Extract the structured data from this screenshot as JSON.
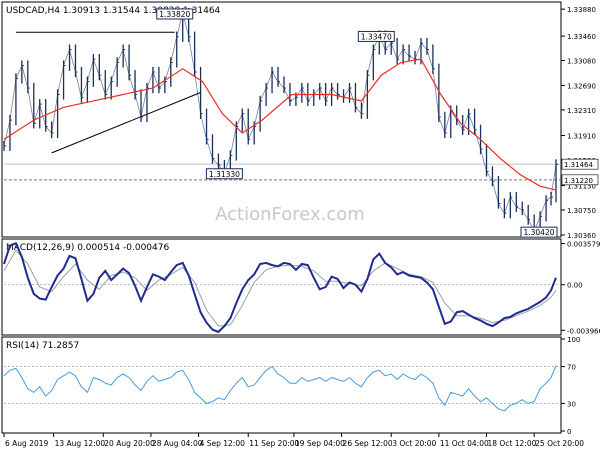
{
  "colors": {
    "background": "#ffffff",
    "frame": "#000000",
    "price_bars": "#1a2e5a",
    "moving_average": "#e8302a",
    "macd_line": "#1f2c8f",
    "macd_signal": "#9aa0a6",
    "rsi_line": "#4a9bd8",
    "level_line": "#7a7a7a",
    "label_border": "#1a2e5a",
    "watermark": "#c8c8c8"
  },
  "watermark": "ActionForex.com",
  "chart_data": [
    {
      "type": "line",
      "panel": "price",
      "title": "USDCAD,H4  1.30913 1.31544 1.30828 1.31464",
      "ylim": [
        1.3036,
        1.3396
      ],
      "y_ticks": [
        1.3388,
        1.3346,
        1.3308,
        1.3269,
        1.3231,
        1.3191,
        1.3153,
        1.3113,
        1.3075,
        1.3036
      ],
      "y_tick_labels": [
        "1.33880",
        "1.33460",
        "1.33080",
        "1.32690",
        "1.32310",
        "1.31910",
        "1.31530",
        "1.31130",
        "1.30750",
        "1.30360"
      ],
      "current_price_label": "1.31464",
      "current_price": 1.31464,
      "level_label": "1.31220",
      "level_price": 1.3122,
      "series": [
        {
          "name": "",
          "kind": "price",
          "x": [
            0,
            6,
            12,
            18,
            24,
            30,
            36,
            42,
            48,
            54,
            60,
            66,
            72,
            78,
            84,
            90,
            96,
            102,
            108,
            114,
            120,
            126,
            132,
            138,
            144,
            150,
            156,
            162,
            168,
            174,
            180,
            186,
            192,
            198,
            204,
            210,
            216,
            222,
            228,
            234,
            240,
            246,
            252,
            258,
            264,
            270,
            276,
            282,
            288,
            294,
            300,
            306,
            312,
            318,
            324,
            330,
            336,
            342,
            348,
            354,
            360,
            366,
            372,
            378,
            384,
            390,
            396,
            402,
            408,
            414,
            420,
            426,
            432,
            438,
            444,
            450,
            456,
            462,
            468,
            474,
            480,
            486,
            492,
            498,
            504,
            510,
            516,
            522,
            528,
            534,
            540,
            546,
            551,
            556
          ],
          "values": [
            1.3175,
            1.3215,
            1.328,
            1.33,
            1.3265,
            1.321,
            1.324,
            1.3205,
            1.3195,
            1.3255,
            1.33,
            1.3325,
            1.329,
            1.325,
            1.3275,
            1.331,
            1.3285,
            1.3255,
            1.3275,
            1.3305,
            1.3325,
            1.3285,
            1.3255,
            1.322,
            1.3265,
            1.329,
            1.3265,
            1.3275,
            1.3305,
            1.3345,
            1.3382,
            1.3345,
            1.329,
            1.3225,
            1.3185,
            1.3155,
            1.3145,
            1.3133,
            1.316,
            1.3205,
            1.3225,
            1.3185,
            1.3205,
            1.3245,
            1.3265,
            1.329,
            1.3275,
            1.3265,
            1.3245,
            1.325,
            1.3265,
            1.3245,
            1.3255,
            1.3265,
            1.3245,
            1.3265,
            1.3255,
            1.325,
            1.3265,
            1.3235,
            1.3225,
            1.3285,
            1.3325,
            1.3347,
            1.3325,
            1.3335,
            1.331,
            1.3325,
            1.3315,
            1.331,
            1.3335,
            1.3325,
            1.3295,
            1.322,
            1.3195,
            1.323,
            1.3215,
            1.32,
            1.3225,
            1.32,
            1.317,
            1.3135,
            1.312,
            1.3085,
            1.307,
            1.3095,
            1.308,
            1.3075,
            1.306,
            1.3042,
            1.3065,
            1.309,
            1.3095,
            1.3146
          ]
        },
        {
          "name": "",
          "kind": "moving-average",
          "x": [
            0,
            30,
            60,
            90,
            120,
            150,
            180,
            200,
            220,
            240,
            260,
            290,
            330,
            360,
            380,
            400,
            420,
            440,
            460,
            480,
            500,
            520,
            540,
            556
          ],
          "values": [
            1.3185,
            1.3215,
            1.3235,
            1.3245,
            1.3255,
            1.3265,
            1.3295,
            1.3275,
            1.3225,
            1.3195,
            1.3215,
            1.3255,
            1.3255,
            1.3245,
            1.3285,
            1.3305,
            1.331,
            1.3255,
            1.321,
            1.3185,
            1.3155,
            1.313,
            1.3112,
            1.3106
          ]
        }
      ],
      "annotations": [
        {
          "label": "1.33820",
          "x": 172,
          "value": 1.3382
        },
        {
          "label": "1.33470",
          "x": 375,
          "value": 1.3347
        },
        {
          "label": "1.31330",
          "x": 222,
          "value": 1.3133
        },
        {
          "label": "1.30420",
          "x": 540,
          "value": 1.3042
        }
      ],
      "channel": {
        "upper": {
          "x": [
            12,
            172
          ],
          "values": [
            1.3352,
            1.3352
          ]
        },
        "lower": {
          "x": [
            48,
            198
          ],
          "values": [
            1.3164,
            1.3258
          ]
        }
      }
    },
    {
      "type": "line",
      "panel": "macd",
      "title": "MACD(12,26,9) 0.000514 -0.000476",
      "ylim": [
        -0.0042,
        0.0038
      ],
      "y_ticks": [
        0.003579,
        0.0,
        -0.003966
      ],
      "y_tick_labels": [
        "0.003579",
        "0.00",
        "-0.003966"
      ],
      "series": [
        {
          "name": "",
          "kind": "macd",
          "x": [
            0,
            6,
            12,
            18,
            24,
            30,
            36,
            42,
            48,
            54,
            60,
            66,
            72,
            78,
            84,
            90,
            96,
            102,
            108,
            114,
            120,
            126,
            132,
            138,
            144,
            150,
            156,
            162,
            168,
            174,
            180,
            186,
            192,
            198,
            204,
            210,
            216,
            222,
            228,
            234,
            240,
            246,
            252,
            258,
            264,
            270,
            276,
            282,
            288,
            294,
            300,
            306,
            312,
            318,
            324,
            330,
            336,
            342,
            348,
            354,
            360,
            366,
            372,
            378,
            384,
            390,
            396,
            402,
            408,
            414,
            420,
            426,
            432,
            438,
            444,
            450,
            456,
            462,
            468,
            474,
            480,
            486,
            492,
            498,
            504,
            510,
            516,
            522,
            528,
            534,
            540,
            546,
            551,
            556
          ],
          "values": [
            0.0018,
            0.0034,
            0.0036,
            0.0024,
            0.0006,
            -0.0008,
            -0.0012,
            -0.0013,
            -0.0002,
            0.0008,
            0.0014,
            0.0025,
            0.0023,
            0.0005,
            -0.0014,
            -0.0008,
            0.0006,
            0.0012,
            0.0004,
            0.0009,
            0.0014,
            0.001,
            -0.0001,
            -0.0014,
            -0.0002,
            0.0009,
            0.0007,
            0.0004,
            0.0011,
            0.0017,
            0.0019,
            0.0008,
            -0.0008,
            -0.0024,
            -0.0033,
            -0.0039,
            -0.0041,
            -0.0036,
            -0.0029,
            -0.0016,
            -0.0004,
            0.0004,
            0.0009,
            0.0018,
            0.0019,
            0.0017,
            0.0016,
            0.0019,
            0.0018,
            0.0013,
            0.0018,
            0.0017,
            0.0006,
            -0.0004,
            -0.0002,
            0.0007,
            0.0005,
            -0.0003,
            0.0002,
            0.0,
            -0.0006,
            0.0005,
            0.0022,
            0.0027,
            0.0019,
            0.0015,
            0.0009,
            0.0011,
            0.0008,
            0.0007,
            0.0006,
            0.0002,
            -0.0004,
            -0.0019,
            -0.0034,
            -0.0032,
            -0.0024,
            -0.0023,
            -0.0026,
            -0.0029,
            -0.0031,
            -0.0034,
            -0.0036,
            -0.0033,
            -0.0029,
            -0.0028,
            -0.0025,
            -0.0023,
            -0.0021,
            -0.0018,
            -0.0015,
            -0.0011,
            -0.0005,
            0.0006
          ]
        },
        {
          "name": "",
          "kind": "signal",
          "x": [
            0,
            12,
            24,
            36,
            48,
            60,
            72,
            84,
            96,
            108,
            120,
            132,
            144,
            156,
            168,
            180,
            192,
            204,
            216,
            228,
            240,
            252,
            264,
            276,
            288,
            300,
            312,
            324,
            336,
            348,
            360,
            372,
            384,
            396,
            408,
            420,
            432,
            444,
            456,
            468,
            480,
            492,
            504,
            516,
            528,
            540,
            551,
            556
          ],
          "values": [
            0.0012,
            0.003,
            0.0018,
            -0.0002,
            -0.0006,
            0.0007,
            0.0018,
            0.0004,
            -0.0004,
            0.0008,
            0.0011,
            0.0006,
            -0.0005,
            0.0004,
            0.0009,
            0.0015,
            0.0002,
            -0.0022,
            -0.0036,
            -0.0035,
            -0.0018,
            0.0002,
            0.0013,
            0.0016,
            0.0017,
            0.0016,
            0.0012,
            0.0003,
            0.0003,
            0.0001,
            -0.0001,
            0.0012,
            0.0019,
            0.0014,
            0.0009,
            0.0007,
            0.0002,
            -0.0016,
            -0.0027,
            -0.0027,
            -0.0029,
            -0.0033,
            -0.0031,
            -0.0027,
            -0.0023,
            -0.0018,
            -0.0011,
            -0.0005
          ]
        }
      ]
    },
    {
      "type": "line",
      "panel": "rsi",
      "title": "RSI(14) 71.2857",
      "ylim": [
        0,
        100
      ],
      "y_ticks": [
        100,
        70,
        30,
        0
      ],
      "y_tick_labels": [
        "100",
        "70",
        "30",
        "0"
      ],
      "series": [
        {
          "name": "",
          "kind": "rsi",
          "x": [
            0,
            6,
            12,
            18,
            24,
            30,
            36,
            42,
            48,
            54,
            60,
            66,
            72,
            78,
            84,
            90,
            96,
            102,
            108,
            114,
            120,
            126,
            132,
            138,
            144,
            150,
            156,
            162,
            168,
            174,
            180,
            186,
            192,
            198,
            204,
            210,
            216,
            222,
            228,
            234,
            240,
            246,
            252,
            258,
            264,
            270,
            276,
            282,
            288,
            294,
            300,
            306,
            312,
            318,
            324,
            330,
            336,
            342,
            348,
            354,
            360,
            366,
            372,
            378,
            384,
            390,
            396,
            402,
            408,
            414,
            420,
            426,
            432,
            438,
            444,
            450,
            456,
            462,
            468,
            474,
            480,
            486,
            492,
            498,
            504,
            510,
            516,
            522,
            528,
            534,
            540,
            546,
            551,
            556
          ],
          "values": [
            60,
            66,
            68,
            58,
            46,
            42,
            48,
            38,
            44,
            56,
            60,
            64,
            60,
            48,
            42,
            58,
            56,
            52,
            50,
            58,
            62,
            58,
            50,
            44,
            54,
            60,
            54,
            56,
            58,
            64,
            66,
            56,
            42,
            36,
            30,
            32,
            36,
            34,
            44,
            52,
            58,
            48,
            50,
            58,
            66,
            70,
            62,
            58,
            52,
            52,
            58,
            54,
            56,
            58,
            54,
            58,
            56,
            54,
            58,
            52,
            48,
            58,
            64,
            66,
            60,
            62,
            56,
            62,
            58,
            56,
            62,
            58,
            52,
            36,
            28,
            42,
            40,
            38,
            46,
            38,
            32,
            36,
            30,
            24,
            22,
            28,
            30,
            34,
            30,
            32,
            46,
            52,
            58,
            71
          ]
        }
      ]
    }
  ],
  "x_axis": {
    "tick_labels": [
      "6 Aug 2019",
      "13 Aug 12:00",
      "20 Aug 20:00",
      "28 Aug 04:00",
      "4 Sep 12:00",
      "11 Sep 20:00",
      "19 Sep 04:00",
      "26 Sep 12:00",
      "3 Oct 20:00",
      "11 Oct 04:00",
      "18 Oct 12:00",
      "25 Oct 20:00"
    ],
    "tick_positions": [
      0,
      50,
      100,
      148,
      196,
      246,
      292,
      340,
      390,
      438,
      486,
      534
    ]
  }
}
